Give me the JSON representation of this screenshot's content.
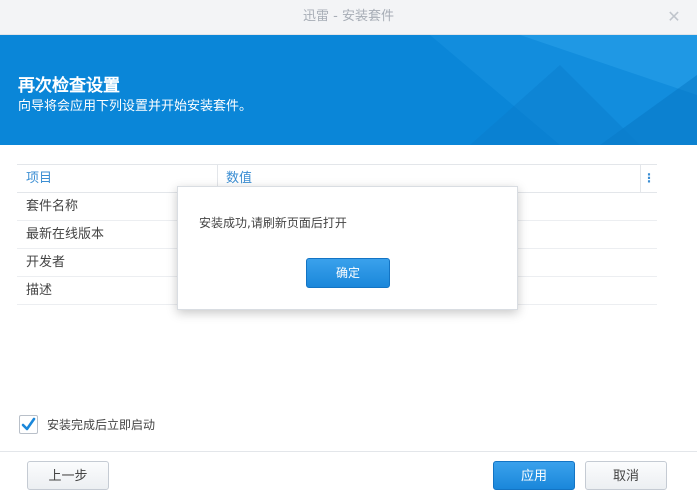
{
  "window": {
    "title": "迅雷 - 安装套件",
    "close_glyph": "✕"
  },
  "banner": {
    "title": "再次检查设置",
    "subtitle": "向导将会应用下列设置并开始安装套件。",
    "color": "#0a86d8"
  },
  "grid": {
    "columns": [
      "项目",
      "数值"
    ],
    "menu_glyph": "⋮",
    "rows": [
      {
        "item": "套件名称"
      },
      {
        "item": "最新在线版本"
      },
      {
        "item": "开发者"
      },
      {
        "item": "描述"
      }
    ]
  },
  "dialog": {
    "message": "安装成功,请刷新页面后打开",
    "ok_label": "确定"
  },
  "options": {
    "start_after_install_label": "安装完成后立即启动",
    "start_after_install_checked": true
  },
  "footer": {
    "back_label": "上一步",
    "apply_label": "应用",
    "cancel_label": "取消"
  },
  "colors": {
    "accent": "#1a87da",
    "link": "#3b8ed3"
  }
}
